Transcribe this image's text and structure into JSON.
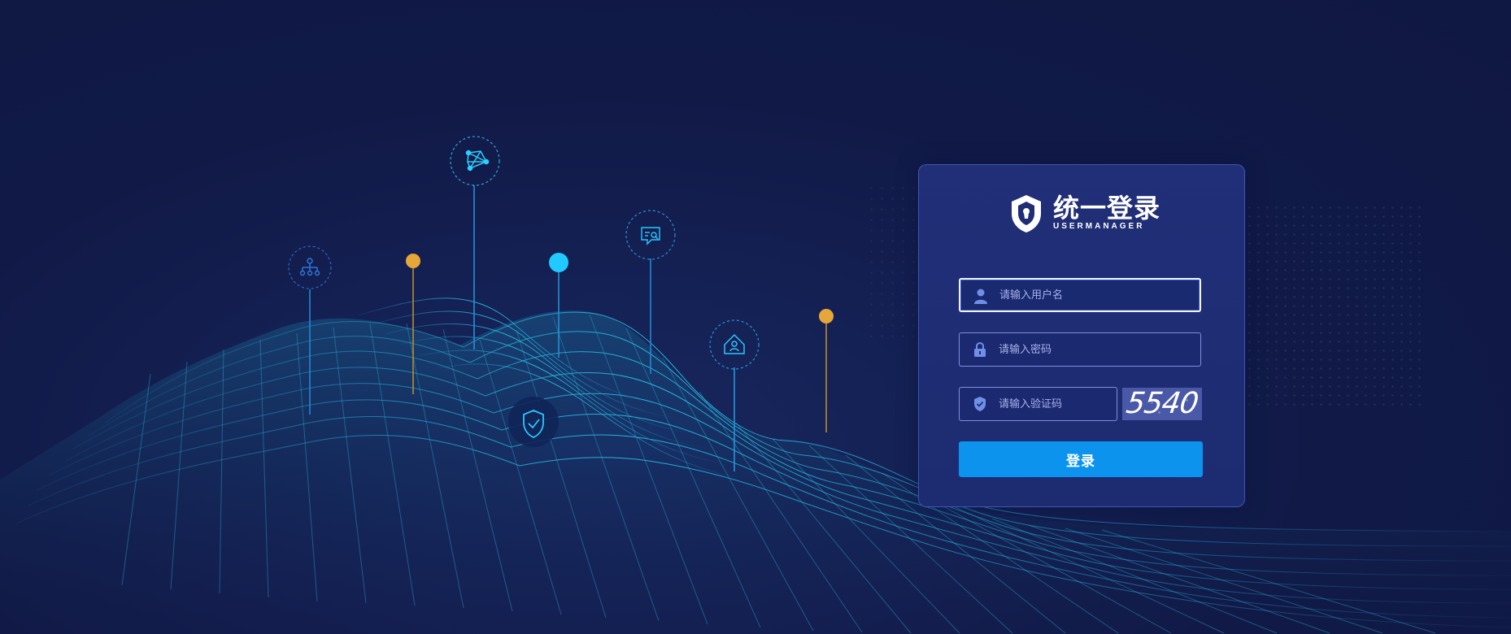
{
  "brand": {
    "title": "统一登录",
    "subtitle": "USERMANAGER",
    "logo_icon": "shield-keyhole-logo"
  },
  "form": {
    "username_placeholder": "请输入用户名",
    "password_placeholder": "请输入密码",
    "captcha_placeholder": "请输入验证码",
    "captcha_text": "5540",
    "login_button": "登录"
  },
  "icons": {
    "username": "user-icon",
    "password": "lock-icon",
    "captcha": "shield-check-icon",
    "pins": [
      "network-tree-icon",
      "graph-network-icon",
      "chat-search-icon",
      "home-user-icon",
      "shield-check-icon"
    ]
  },
  "colors": {
    "background": "#111a47",
    "card": "#1f2d75",
    "accent": "#0b93ee",
    "cyan": "#1fd2ff",
    "gold": "#e6a739",
    "mesh": "#25a9ca"
  }
}
